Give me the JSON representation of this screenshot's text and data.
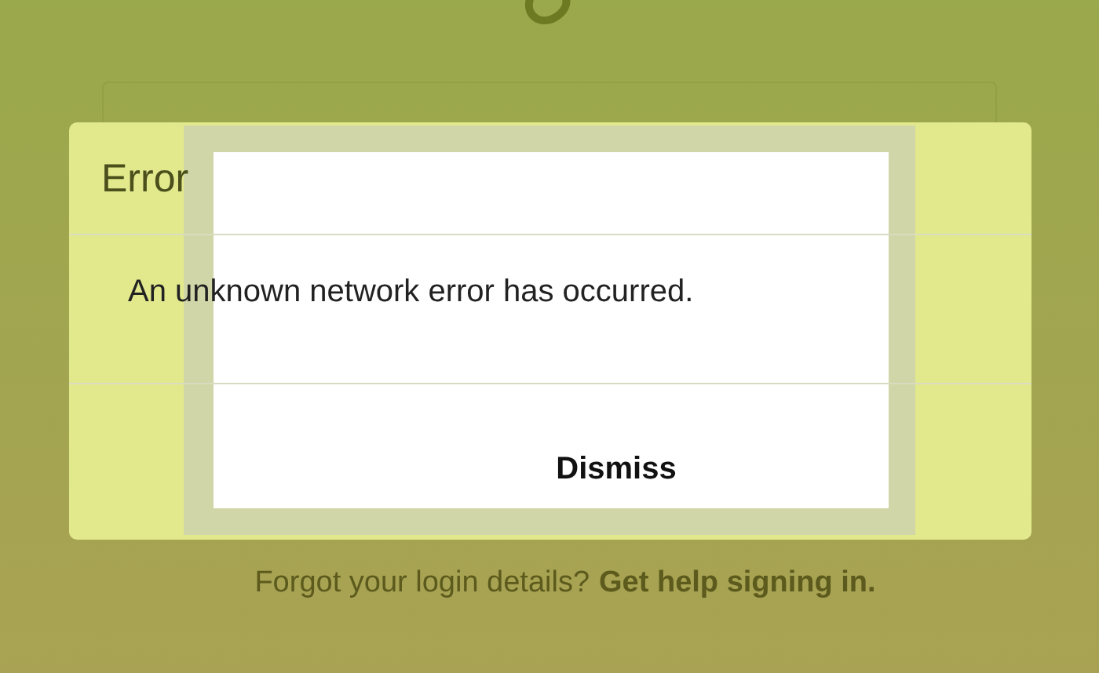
{
  "dialog": {
    "title": "Error",
    "message": "An unknown network error has occurred.",
    "button": "Dismiss"
  },
  "footer": {
    "text": "Forgot your login details?",
    "link": "Get help signing in."
  }
}
